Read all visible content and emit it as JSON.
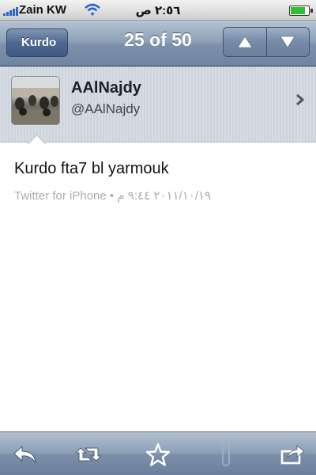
{
  "status_bar": {
    "carrier": "Zain KW",
    "time": "٢:٥٦ ص",
    "battery_level": 0.85,
    "signal_bars": 5
  },
  "nav": {
    "back_label": "Kurdo",
    "title": "25 of 50",
    "prev_icon": "triangle-up-icon",
    "next_icon": "triangle-down-icon"
  },
  "profile": {
    "display_name": "AAlNajdy",
    "username": "@AAlNajdy"
  },
  "tweet": {
    "text": "Kurdo fta7 bl yarmouk",
    "source": "Twitter for iPhone",
    "separator": "•",
    "timestamp": "٢٠١١/١٠/١٩ ٩:٤٤ م"
  },
  "toolbar": {
    "icons": [
      "reply-icon",
      "retweet-icon",
      "star-icon",
      "paperclip-icon",
      "share-icon"
    ]
  },
  "colors": {
    "nav_accent": "#7d91aa",
    "meta_text": "#a9acb0",
    "battery": "#2fbf2f"
  }
}
